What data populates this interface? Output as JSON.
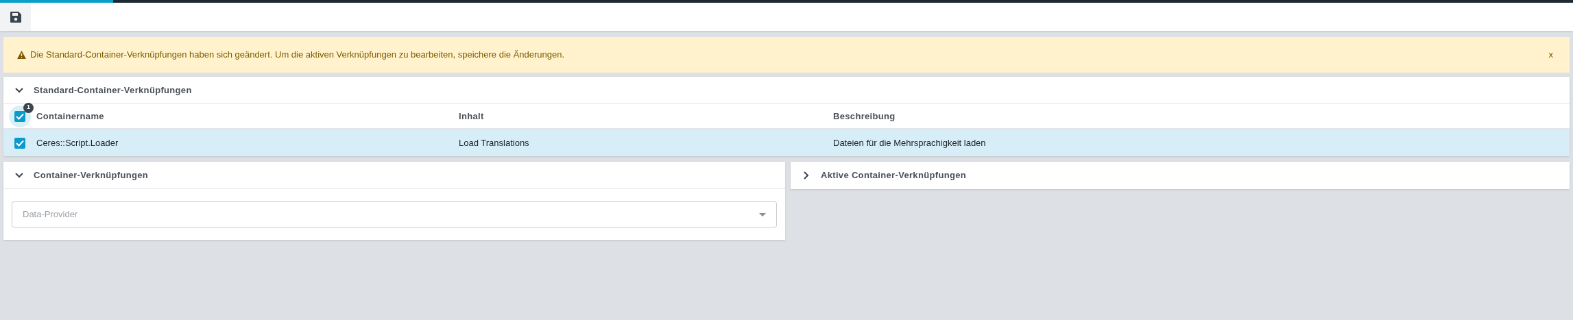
{
  "progress": {
    "level": 0.072
  },
  "alert": {
    "message": "Die Standard-Container-Verknüpfungen haben sich geändert. Um die aktiven Verknüpfungen zu bearbeiten, speichere die Änderungen.",
    "close": "x"
  },
  "standard_panel": {
    "title": "Standard-Container-Verknüpfungen",
    "expanded": true,
    "select_all": {
      "checked": true,
      "badge": "1"
    },
    "columns": [
      "Containername",
      "Inhalt",
      "Beschreibung"
    ],
    "rows": [
      {
        "cells": [
          "Ceres::Script.Loader",
          "Load Translations",
          "Dateien für die Mehrsprachigkeit laden"
        ],
        "checked": true,
        "selected": true
      }
    ]
  },
  "container_panel": {
    "title": "Container-Verknüpfungen",
    "expanded": true,
    "select": {
      "placeholder": "Data-Provider"
    }
  },
  "active_panel": {
    "title": "Aktive Container-Verknüpfungen",
    "expanded": false
  }
}
